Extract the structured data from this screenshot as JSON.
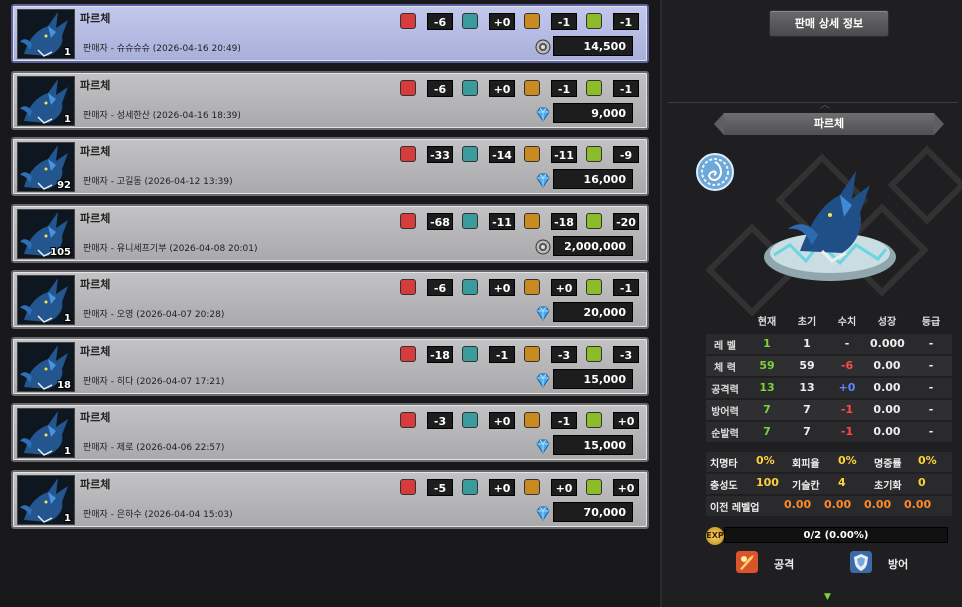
{
  "listings": [
    {
      "name": "파르체",
      "level": "1",
      "seller": "판매자 - 슈슈슈슈 (2026-04-16 20:49)",
      "hp": "-6",
      "atk": "+0",
      "def": "-1",
      "agi": "-1",
      "price": "14,500",
      "currency": "gold-coin-icon",
      "selected": true
    },
    {
      "name": "파르체",
      "level": "1",
      "seller": "판매자 - 성세한산 (2026-04-16 18:39)",
      "hp": "-6",
      "atk": "+0",
      "def": "-1",
      "agi": "-1",
      "price": "9,000",
      "currency": "diamond-icon",
      "selected": false
    },
    {
      "name": "파르체",
      "level": "92",
      "seller": "판매자 - 고길동 (2026-04-12 13:39)",
      "hp": "-33",
      "atk": "-14",
      "def": "-11",
      "agi": "-9",
      "price": "16,000",
      "currency": "diamond-icon",
      "selected": false
    },
    {
      "name": "파르체",
      "level": "105",
      "seller": "판매자 - 유니세프기부 (2026-04-08 20:01)",
      "hp": "-68",
      "atk": "-11",
      "def": "-18",
      "agi": "-20",
      "price": "2,000,000",
      "currency": "gold-coin-icon",
      "selected": false
    },
    {
      "name": "파르체",
      "level": "1",
      "seller": "판매자 - 오영 (2026-04-07 20:28)",
      "hp": "-6",
      "atk": "+0",
      "def": "+0",
      "agi": "-1",
      "price": "20,000",
      "currency": "diamond-icon",
      "selected": false
    },
    {
      "name": "파르체",
      "level": "18",
      "seller": "판매자 - 히다 (2026-04-07 17:21)",
      "hp": "-18",
      "atk": "-1",
      "def": "-3",
      "agi": "-3",
      "price": "15,000",
      "currency": "diamond-icon",
      "selected": false
    },
    {
      "name": "파르체",
      "level": "1",
      "seller": "판매자 - 제로 (2026-04-06 22:57)",
      "hp": "-3",
      "atk": "+0",
      "def": "-1",
      "agi": "+0",
      "price": "15,000",
      "currency": "diamond-icon",
      "selected": false
    },
    {
      "name": "파르체",
      "level": "1",
      "seller": "판매자 - 은하수 (2026-04-04 15:03)",
      "hp": "-5",
      "atk": "+0",
      "def": "+0",
      "agi": "+0",
      "price": "70,000",
      "currency": "diamond-icon",
      "selected": false
    }
  ],
  "detail": {
    "button_label": "판매 상세 정보",
    "pet_name": "파르체",
    "element_icon": "water-element-icon",
    "table_headers": [
      "현재",
      "초기",
      "수치",
      "성장",
      "등급"
    ],
    "rows": [
      {
        "label": "레 벨",
        "current": "1",
        "initial": "1",
        "value": "-",
        "growth": "0.000",
        "grade": "-"
      },
      {
        "label": "체 력",
        "current": "59",
        "initial": "59",
        "value": "-6",
        "growth": "0.00",
        "grade": "-"
      },
      {
        "label": "공격력",
        "current": "13",
        "initial": "13",
        "value": "+0",
        "growth": "0.00",
        "grade": "-"
      },
      {
        "label": "방어력",
        "current": "7",
        "initial": "7",
        "value": "-1",
        "growth": "0.00",
        "grade": "-"
      },
      {
        "label": "순발력",
        "current": "7",
        "initial": "7",
        "value": "-1",
        "growth": "0.00",
        "grade": "-"
      }
    ],
    "extra1": [
      {
        "label": "치명타",
        "value": "0%"
      },
      {
        "label": "회피율",
        "value": "0%"
      },
      {
        "label": "명중률",
        "value": "0%"
      }
    ],
    "extra2": [
      {
        "label": "충성도",
        "value": "100"
      },
      {
        "label": "기술칸",
        "value": "4"
      },
      {
        "label": "초기화",
        "value": "0"
      }
    ],
    "prev_level_label": "이전 레벨업",
    "prev_level_values": [
      "0.00",
      "0.00",
      "0.00",
      "0.00"
    ],
    "exp_icon_text": "EXP",
    "exp_text": "0/2 (0.00%)",
    "exp_fraction": 0,
    "skills": [
      {
        "label": "공격",
        "icon": "attack-skill-icon"
      },
      {
        "label": "방어",
        "icon": "defense-skill-icon"
      }
    ]
  }
}
